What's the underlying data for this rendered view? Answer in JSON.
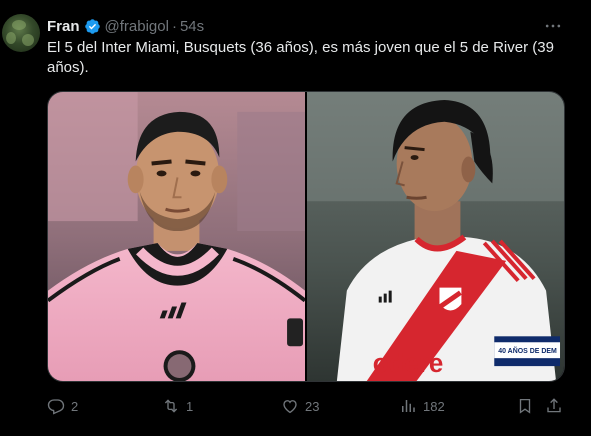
{
  "author": {
    "name": "Fran",
    "handle": "@frabigol",
    "separator": "·",
    "time": "54s"
  },
  "tweet": {
    "text": "El 5 del Inter Miami, Busquets (36 años), es más joven que el 5 de River (39 años)."
  },
  "media": {
    "left_photo": {
      "shirt_text": ""
    },
    "right_photo": {
      "sponsor": "odere",
      "armband": "40 AÑOS DE DEM"
    }
  },
  "actions": {
    "replies": "2",
    "retweets": "1",
    "likes": "23",
    "views": "182"
  },
  "icons": {
    "more": "more-icon",
    "reply": "reply-icon",
    "retweet": "retweet-icon",
    "like": "like-icon",
    "views": "views-icon",
    "bookmark": "bookmark-icon",
    "share": "share-icon"
  },
  "colors": {
    "background": "#000000",
    "text_primary": "#e7e9ea",
    "text_secondary": "#71767b",
    "verified": "#1d9bf0",
    "miami_pink": "#f5b3c9",
    "river_red": "#d6262f"
  }
}
